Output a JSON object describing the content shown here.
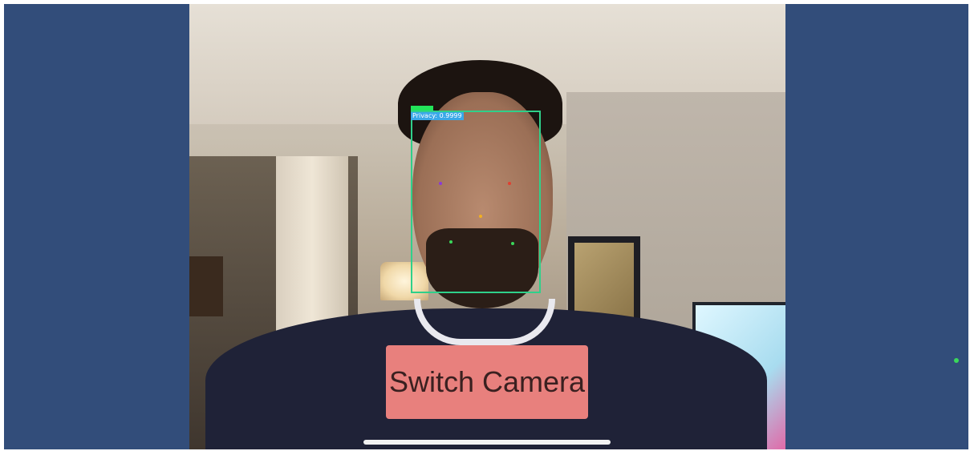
{
  "camera_view": {
    "detection": {
      "label": "Privacy: 0.9999",
      "box_color": "#2fd08a",
      "tag_color": "#23e45a",
      "label_bg": "#3aa8e8",
      "landmark_colors": [
        "#8b3ad8",
        "#e04030",
        "#f2b020",
        "#3ad85a",
        "#3ad85a"
      ]
    }
  },
  "controls": {
    "switch_camera_label": "Switch Camera",
    "button_color": "#e8807d"
  },
  "theme": {
    "background": "#324d7a"
  },
  "status": {
    "indicator_color": "#3ad85a"
  }
}
